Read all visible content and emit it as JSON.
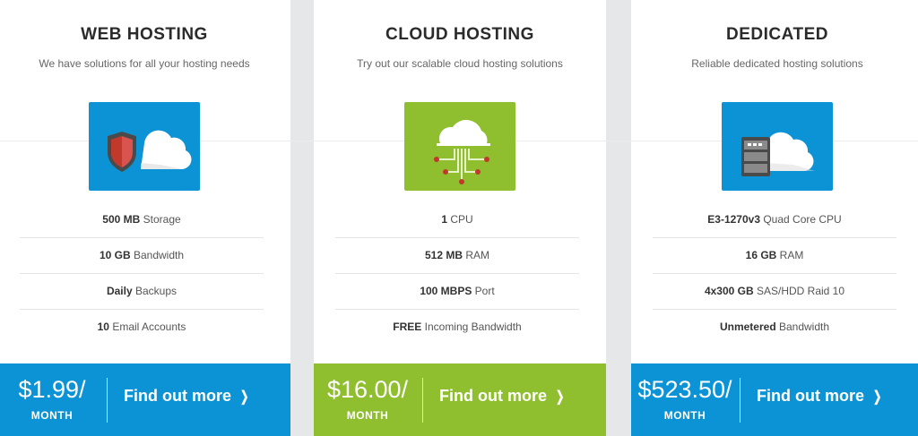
{
  "colors": {
    "blue": "#0b93d6",
    "green": "#8fbf2f",
    "gutter": "#e6e7e8"
  },
  "plans": [
    {
      "title": "WEB HOSTING",
      "subtitle": "We have solutions for all your hosting needs",
      "icon": "shield-cloud-icon",
      "features": [
        {
          "bold": "500 MB",
          "text": " Storage"
        },
        {
          "bold": "10 GB",
          "text": " Bandwidth"
        },
        {
          "bold": "Daily",
          "text": " Backups"
        },
        {
          "bold": "10",
          "text": " Email Accounts"
        }
      ],
      "price": "$1.99/",
      "period": "MONTH",
      "cta": "Find out more"
    },
    {
      "title": "CLOUD HOSTING",
      "subtitle": "Try out our scalable cloud hosting solutions",
      "icon": "cloud-network-icon",
      "features": [
        {
          "bold": "1",
          "text": " CPU"
        },
        {
          "bold": "512 MB",
          "text": " RAM"
        },
        {
          "bold": "100 MBPS",
          "text": " Port"
        },
        {
          "bold": "FREE",
          "text": " Incoming Bandwidth"
        }
      ],
      "price": "$16.00/",
      "period": "MONTH",
      "cta": "Find out more"
    },
    {
      "title": "DEDICATED",
      "subtitle": "Reliable dedicated hosting solutions",
      "icon": "server-cloud-icon",
      "features": [
        {
          "bold": "E3-1270v3",
          "text": " Quad Core CPU"
        },
        {
          "bold": "16 GB",
          "text": " RAM"
        },
        {
          "bold": "4x300 GB",
          "text": " SAS/HDD Raid 10"
        },
        {
          "bold": "Unmetered",
          "text": " Bandwidth"
        }
      ],
      "price": "$523.50/",
      "period": "MONTH",
      "cta": "Find out more"
    }
  ]
}
